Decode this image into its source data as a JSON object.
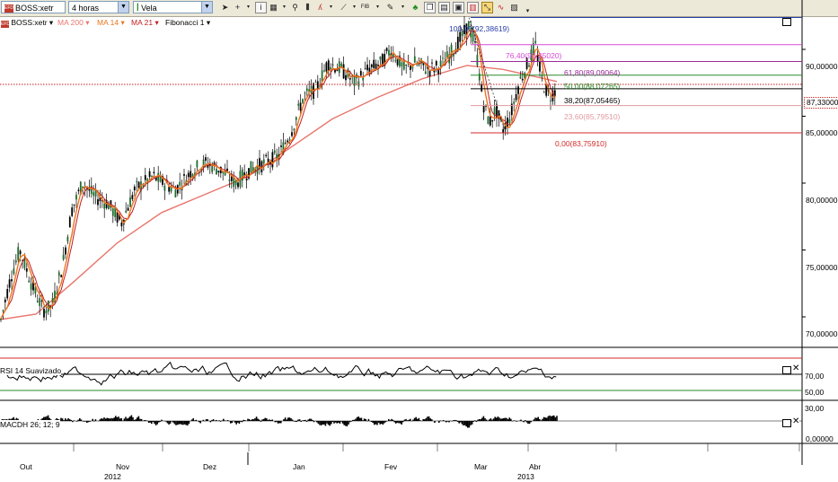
{
  "toolbar": {
    "symbol": "BOSS:xetr",
    "timeframe": "4 horas",
    "chart_style": "Vela",
    "fib_button_label": "FIB"
  },
  "legend": {
    "symbol": "BOSS:xetr",
    "ma200": "MA 200",
    "ma14": "MA 14",
    "ma21": "MA 21",
    "fibo": "Fibonacci 1"
  },
  "colors": {
    "ma200": "#e8766d",
    "ma14": "#e8761e",
    "ma21": "#c41e1e",
    "fib100": "#2a3fa8",
    "fib764": "#d44ad4",
    "fib618": "#9b2a9b",
    "fib50": "#2a8a2a",
    "fib382": "#000000",
    "fib236": "#e09aa0",
    "fib0": "#d42a2a",
    "rsi_upper": "#d42a2a",
    "rsi_lower": "#2a8a2a"
  },
  "price_pane": {
    "y_labels": [
      "90,00000",
      "85,00000",
      "80,00000",
      "75,00000",
      "70,00000"
    ],
    "current_price": "87,33000",
    "fib_levels": [
      {
        "label": "100,00(92,38619)",
        "price": 92.38619,
        "color": "#2a3fa8"
      },
      {
        "label": "76,40(90,35020)",
        "price": 90.3502,
        "color": "#d44ad4"
      },
      {
        "label": "61,80(89,09064)",
        "price": 89.09064,
        "color": "#9b2a9b"
      },
      {
        "label": "50,00(88,07265)",
        "price": 88.07265,
        "color": "#2a8a2a"
      },
      {
        "label": "38,20(87,05465)",
        "price": 87.05465,
        "color": "#000000"
      },
      {
        "label": "23,60(85,79510)",
        "price": 85.7951,
        "color": "#e09aa0"
      },
      {
        "label": "0,00(83,75910)",
        "price": 83.7591,
        "color": "#d42a2a"
      }
    ]
  },
  "rsi_pane": {
    "title": "RSI 14 Suavizado",
    "labels": [
      "70,00",
      "50,00",
      "30,00"
    ]
  },
  "macd_pane": {
    "title": "MACDH 26; 12; 9",
    "label": "0,00000"
  },
  "xaxis": {
    "months": [
      "Out",
      "Nov",
      "Dez",
      "Jan",
      "Fev",
      "Mar",
      "Abr"
    ],
    "years": [
      "2012",
      "2013"
    ]
  }
}
